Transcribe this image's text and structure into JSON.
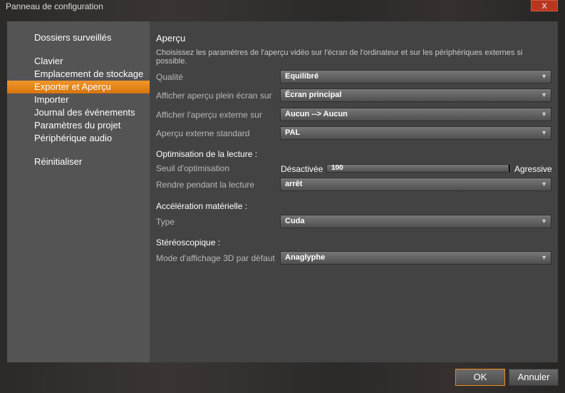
{
  "window": {
    "title": "Panneau de configuration",
    "close_label": "X"
  },
  "sidebar": {
    "items": [
      {
        "label": "Dossiers surveillés"
      },
      {
        "label": "Clavier"
      },
      {
        "label": "Emplacement de stockage"
      },
      {
        "label": "Exporter et Aperçu",
        "selected": true
      },
      {
        "label": "Importer"
      },
      {
        "label": "Journal des événements"
      },
      {
        "label": "Paramètres du projet"
      },
      {
        "label": "Périphérique audio"
      },
      {
        "label": "Réinitialiser"
      }
    ]
  },
  "main": {
    "heading": "Aperçu",
    "description": "Choisissez les paramètres de l'aperçu vidéo sur l'écran de l'ordinateur et sur les périphériques externes si possible.",
    "rows": [
      {
        "label": "Qualité",
        "value": "Equilibré"
      },
      {
        "label": "Afficher aperçu plein écran sur",
        "value": "Écran principal"
      },
      {
        "label": "Afficher l'aperçu externe sur",
        "value": "Aucun --> Aucun"
      },
      {
        "label": "Aperçu externe standard",
        "value": "PAL"
      }
    ],
    "playback": {
      "heading": "Optimisation de la lecture :",
      "threshold_label": "Seuil d'optimisation",
      "slider_min_label": "Désactivée",
      "slider_max_label": "Agressive",
      "slider_value": "100",
      "slider_fraction": 1.0,
      "render_label": "Rendre pendant la lecture",
      "render_value": "arrêt"
    },
    "hardware": {
      "heading": "Accélération matérielle :",
      "type_label": "Type",
      "type_value": "Cuda"
    },
    "stereo": {
      "heading": "Stéréoscopique :",
      "mode_label": "Mode d'affichage 3D par défaut",
      "mode_value": "Anaglyphe"
    }
  },
  "buttons": {
    "ok": "OK",
    "cancel": "Annuler"
  },
  "colors": {
    "accent": "#f08a18",
    "close": "#b8361f"
  }
}
